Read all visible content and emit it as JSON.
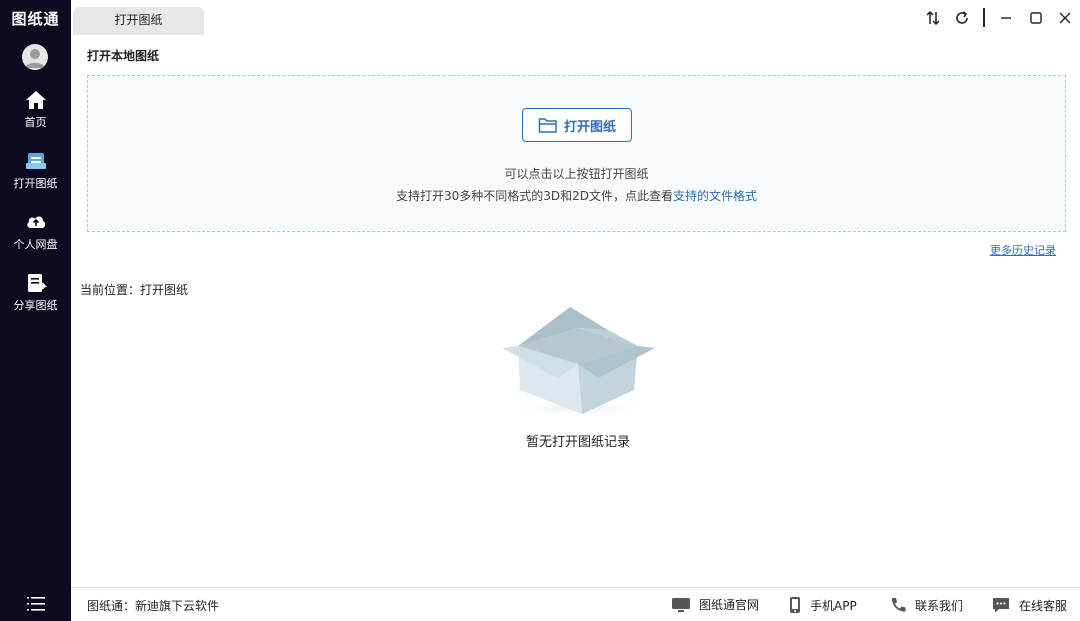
{
  "sidebar": {
    "logo": "图纸通",
    "items": [
      {
        "label": "首页",
        "icon": "home-icon"
      },
      {
        "label": "打开图纸",
        "icon": "open-drawing-icon"
      },
      {
        "label": "个人网盘",
        "icon": "cloud-icon"
      },
      {
        "label": "分享图纸",
        "icon": "share-icon"
      }
    ],
    "menu_icon": "menu-icon"
  },
  "tabs": [
    {
      "label": "打开图纸"
    }
  ],
  "window_controls": [
    "sort-icon",
    "refresh-icon",
    "minimize-icon",
    "maximize-icon",
    "close-icon"
  ],
  "main": {
    "section_title": "打开本地图纸",
    "open_button": "打开图纸",
    "hint_line1": "可以点击以上按钮打开图纸",
    "hint_line2_prefix": "支持打开30多种不同格式的3D和2D文件，点此查看",
    "hint_line2_link": "支持的文件格式",
    "more_history": "更多历史记录",
    "location": "当前位置：打开图纸",
    "empty_text": "暂无打开图纸记录"
  },
  "footer": {
    "left_text": "图纸通：新迪旗下云软件",
    "links": [
      {
        "label": "图纸通官网",
        "icon": "monitor-icon"
      },
      {
        "label": "手机APP",
        "icon": "phone-icon"
      },
      {
        "label": "联系我们",
        "icon": "telephone-icon"
      },
      {
        "label": "在线客服",
        "icon": "chat-icon"
      }
    ]
  },
  "colors": {
    "sidebar_bg": "#0c0b1f",
    "accent": "#2d6cc0",
    "dropzone_border": "#a9c8e4"
  }
}
